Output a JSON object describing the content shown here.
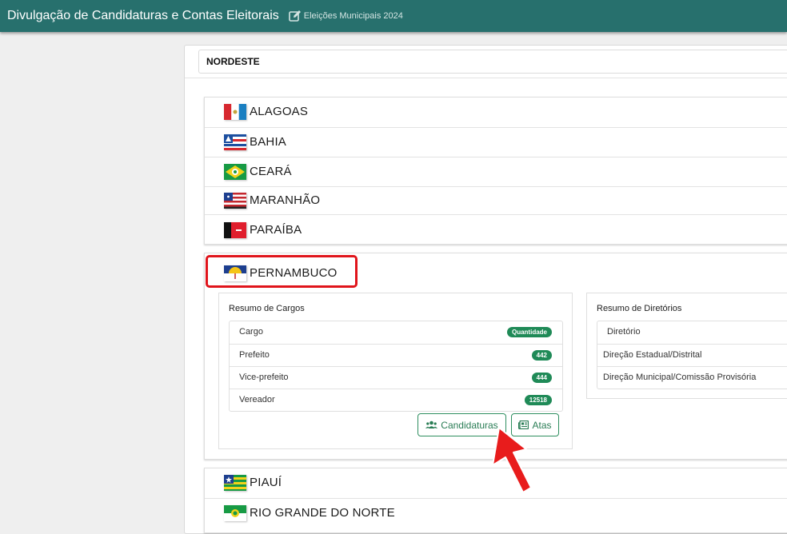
{
  "header": {
    "title": "Divulgação de Candidaturas e Contas Eleitorais",
    "subtitle": "Eleições Municipais 2024",
    "icon": "edit-icon"
  },
  "region": {
    "label": "NORDESTE"
  },
  "states_top": [
    {
      "name": "ALAGOAS",
      "flag": "alagoas"
    },
    {
      "name": "BAHIA",
      "flag": "bahia"
    },
    {
      "name": "CEARÁ",
      "flag": "ceara"
    },
    {
      "name": "MARANHÃO",
      "flag": "maranhao"
    },
    {
      "name": "PARAÍBA",
      "flag": "paraiba"
    }
  ],
  "expanded_state": {
    "name": "PERNAMBUCO",
    "flag": "pernambuco",
    "cargos": {
      "title": "Resumo de Cargos",
      "header": {
        "label": "Cargo",
        "badge": "Quantidade"
      },
      "rows": [
        {
          "label": "Prefeito",
          "count": "442"
        },
        {
          "label": "Vice-prefeito",
          "count": "444"
        },
        {
          "label": "Vereador",
          "count": "12518"
        }
      ],
      "buttons": {
        "candidaturas": {
          "label": "Candidaturas",
          "icon": "users-icon"
        },
        "atas": {
          "label": "Atas",
          "icon": "newspaper-icon"
        }
      }
    },
    "diretorios": {
      "title": "Resumo de Diretórios",
      "header": "Diretório",
      "rows": [
        "Direção Estadual/Distrital",
        "Direção Municipal/Comissão Provisória"
      ]
    }
  },
  "states_bottom": [
    {
      "name": "PIAUÍ",
      "flag": "piaui"
    },
    {
      "name": "RIO GRANDE DO NORTE",
      "flag": "rio-grande-do-norte"
    }
  ],
  "colors": {
    "header_bg": "#27706d",
    "badge": "#1f8a57",
    "button_accent": "#2f8f60",
    "highlight": "#e0141b"
  }
}
